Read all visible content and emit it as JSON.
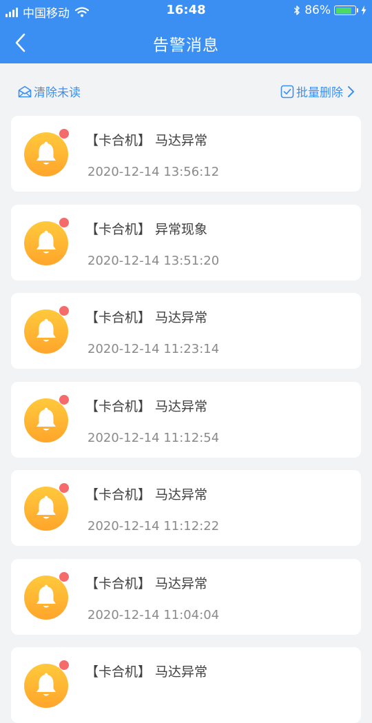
{
  "status_bar": {
    "carrier": "中国移动",
    "time": "16:48",
    "battery_percent": "86%",
    "battery_level": 0.86,
    "icons": [
      "signal-icon",
      "wifi-icon",
      "bluetooth-icon",
      "battery-icon",
      "charging-icon"
    ]
  },
  "nav": {
    "title": "告警消息",
    "back_icon": "chevron-left-icon"
  },
  "toolbar": {
    "clear_unread_label": "清除未读",
    "clear_unread_icon": "envelope-open-icon",
    "batch_delete_label": "批量删除",
    "batch_delete_icon": "checkbox-icon"
  },
  "colors": {
    "primary": "#3b8ff3",
    "bell_gradient_top": "#ffc93c",
    "bell_gradient_bottom": "#ffa52b",
    "unread_dot": "#f56b6b",
    "page_bg": "#f2f3f5"
  },
  "messages": [
    {
      "title": "【卡合机】 马达异常",
      "time": "2020-12-14 13:56:12",
      "unread": true
    },
    {
      "title": "【卡合机】 异常现象",
      "time": "2020-12-14 13:51:20",
      "unread": true
    },
    {
      "title": "【卡合机】 马达异常",
      "time": "2020-12-14 11:23:14",
      "unread": true
    },
    {
      "title": "【卡合机】 马达异常",
      "time": "2020-12-14 11:12:54",
      "unread": true
    },
    {
      "title": "【卡合机】 马达异常",
      "time": "2020-12-14 11:12:22",
      "unread": true
    },
    {
      "title": "【卡合机】 马达异常",
      "time": "2020-12-14 11:04:04",
      "unread": true
    },
    {
      "title": "【卡合机】 马达异常",
      "time": "",
      "unread": true
    }
  ]
}
